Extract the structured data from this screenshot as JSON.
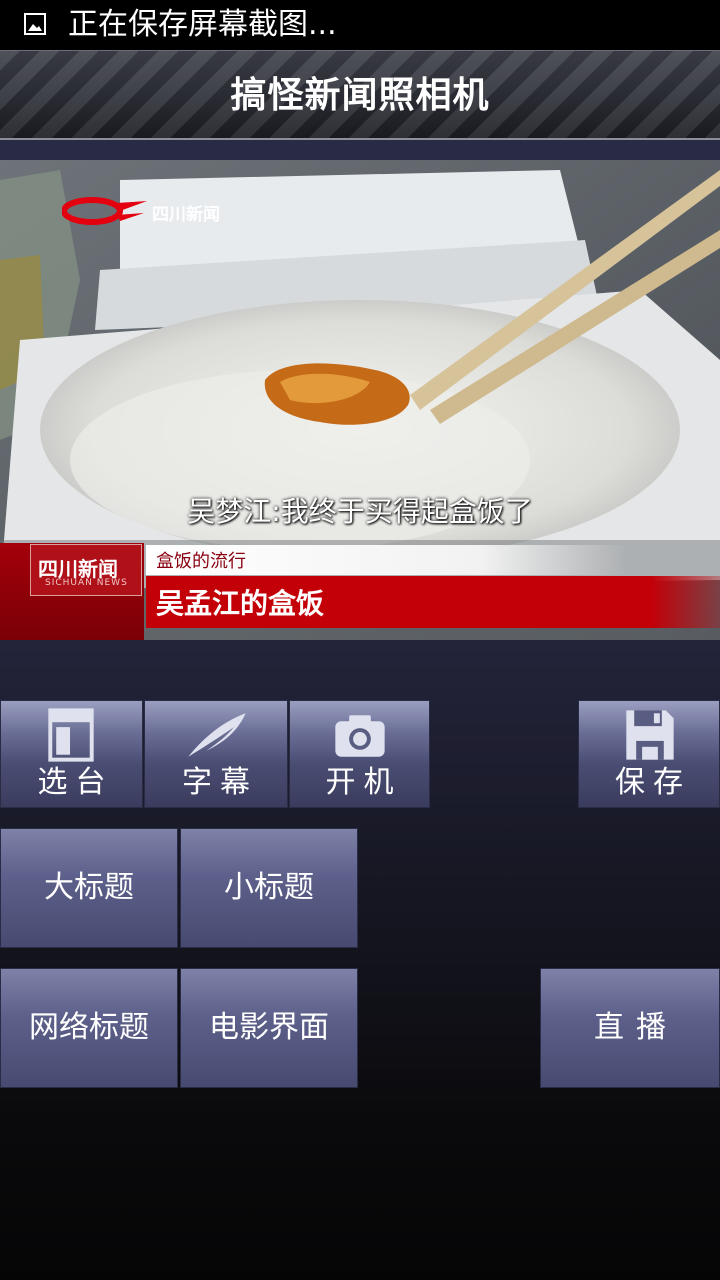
{
  "status_bar": {
    "notification": "正在保存屏幕截图..."
  },
  "app": {
    "title": "搞怪新闻照相机"
  },
  "preview": {
    "station_logo_text": "四川新闻",
    "subtitle": "吴梦江:我终于买得起盒饭了",
    "lower_third_logo_cn": "四川新闻",
    "lower_third_logo_en": "SICHUAN NEWS",
    "small_title": "盒饭的流行",
    "big_title": "吴孟江的盒饭"
  },
  "toolbar": {
    "channel_label": "选台",
    "caption_label": "字幕",
    "camera_label": "开机",
    "save_label": "保存"
  },
  "options": {
    "big_title_label": "大标题",
    "small_title_label": "小标题",
    "web_title_label": "网络标题",
    "movie_ui_label": "电影界面",
    "live_label": "直播"
  },
  "icons": {
    "channel": "channel-layout-icon",
    "caption": "feather-icon",
    "camera": "camera-icon",
    "save": "floppy-disk-icon"
  },
  "colors": {
    "news_red": "#c30008",
    "button_top": "#9a9fc0",
    "button_bottom": "#3a3c5e"
  }
}
